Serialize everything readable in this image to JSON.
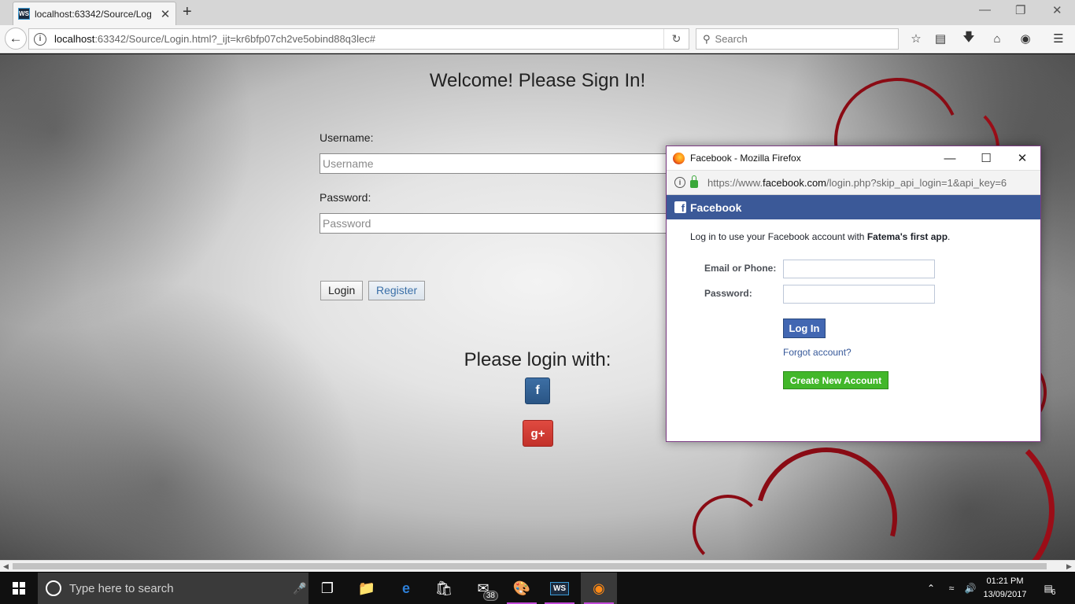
{
  "browser": {
    "tab_favicon": "WS",
    "tab_title": "localhost:63342/Source/Log",
    "tab_close": "✕",
    "new_tab": "+",
    "url_host": "localhost",
    "url_rest": ":63342/Source/Login.html?_ijt=kr6bfp07ch2ve5obind88q3lec#",
    "search_placeholder": "Search",
    "icons": [
      "back-icon",
      "info-icon",
      "reload-icon",
      "search-icon",
      "bookmark-star-icon",
      "reading-list-icon",
      "downloads-icon",
      "home-icon",
      "pocket-icon",
      "menu-icon"
    ]
  },
  "page": {
    "welcome": "Welcome! Please Sign In!",
    "username_label": "Username:",
    "username_placeholder": "Username",
    "password_label": "Password:",
    "password_placeholder": "Password",
    "login_button": "Login",
    "register_button": "Register",
    "please_login_with": "Please login with:",
    "facebook_button": "f",
    "google_button": "g+"
  },
  "popup": {
    "window_title": "Facebook - Mozilla Firefox",
    "url_prefix": "https://www.",
    "url_host": "facebook.com",
    "url_rest": "/login.php?skip_api_login=1&api_key=6",
    "header": "Facebook",
    "header_logo": "f",
    "intro_text": "Log in to use your Facebook account with ",
    "app_name": "Fatema's first app",
    "intro_end": ".",
    "email_label": "Email or Phone:",
    "password_label": "Password:",
    "login_button": "Log In",
    "forgot_link": "Forgot account?",
    "create_button": "Create New Account",
    "brand_color": "#3b5998",
    "create_color": "#42b72a"
  },
  "taskbar": {
    "search_placeholder": "Type here to search",
    "mail_badge": "38",
    "notification_badge": "6",
    "time": "01:21 PM",
    "date": "13/09/2017"
  }
}
